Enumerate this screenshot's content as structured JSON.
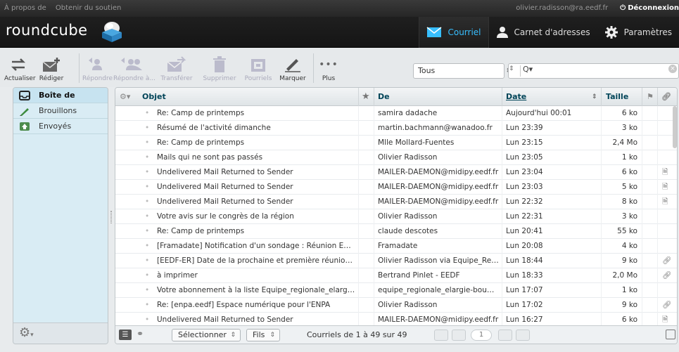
{
  "topline": {
    "about": "À propos de",
    "support": "Obtenir du soutien",
    "user": "olivier.radisson@ra.eedf.fr",
    "logout": "Déconnexion"
  },
  "header": {
    "logo": "roundcube",
    "tasks": [
      {
        "label": "Courriel",
        "icon": "mail-icon",
        "active": true
      },
      {
        "label": "Carnet d'adresses",
        "icon": "contacts-icon",
        "active": false
      },
      {
        "label": "Paramètres",
        "icon": "gear-icon",
        "active": false
      }
    ]
  },
  "toolbar": {
    "refresh": "Actualiser",
    "compose": "Rédiger",
    "reply": "Répondre",
    "reply_all": "Répondre à...",
    "forward": "Transférer",
    "delete": "Supprimer",
    "junk": "Pourriels",
    "mark": "Marquer",
    "more": "Plus",
    "filter_value": "Tous",
    "search_value": ""
  },
  "folders": [
    {
      "label": "Boîte de récep...",
      "icon": "inbox-icon",
      "selected": true
    },
    {
      "label": "Brouillons",
      "icon": "pencil-icon",
      "selected": false
    },
    {
      "label": "Envoyés",
      "icon": "sent-icon",
      "selected": false
    }
  ],
  "list": {
    "headers": {
      "subject": "Objet",
      "from": "De",
      "date": "Date",
      "size": "Taille"
    },
    "rows": [
      {
        "subject": "Re: Camp de printemps",
        "from": "samira dadache",
        "date": "Aujourd'hui 00:01",
        "size": "6 ko",
        "attach": ""
      },
      {
        "subject": "Résumé de l'activité dimanche",
        "from": "martin.bachmann@wanadoo.fr",
        "date": "Lun 23:39",
        "size": "3 ko",
        "attach": ""
      },
      {
        "subject": "Re: Camp de printemps",
        "from": "Mlle Mollard-Fuentes",
        "date": "Lun 23:15",
        "size": "2,4 Mo",
        "attach": ""
      },
      {
        "subject": "Mails qui ne sont pas passés",
        "from": "Olivier Radisson",
        "date": "Lun 23:05",
        "size": "1 ko",
        "attach": ""
      },
      {
        "subject": "Undelivered Mail Returned to Sender",
        "from": "MAILER-DAEMON@midipy.eedf.fr",
        "date": "Lun 23:04",
        "size": "6 ko",
        "attach": "doc"
      },
      {
        "subject": "Undelivered Mail Returned to Sender",
        "from": "MAILER-DAEMON@midipy.eedf.fr",
        "date": "Lun 23:03",
        "size": "5 ko",
        "attach": "doc"
      },
      {
        "subject": "Undelivered Mail Returned to Sender",
        "from": "MAILER-DAEMON@midipy.eedf.fr",
        "date": "Lun 22:32",
        "size": "8 ko",
        "attach": "doc"
      },
      {
        "subject": "Votre avis sur le congrès de la région",
        "from": "Olivier Radisson",
        "date": "Lun 22:31",
        "size": "3 ko",
        "attach": ""
      },
      {
        "subject": "Re: Camp de printemps",
        "from": "claude descotes",
        "date": "Lun 20:41",
        "size": "55 ko",
        "attach": ""
      },
      {
        "subject": "[Framadate] Notification d'un sondage : Réunion ENP...",
        "from": "Framadate",
        "date": "Lun 20:08",
        "size": "4 ko",
        "attach": ""
      },
      {
        "subject": "[EEDF-ER] Date de la prochaine et première réunion ...",
        "from": "Olivier Radisson via Equipe_Regi...",
        "date": "Lun 18:44",
        "size": "9 ko",
        "attach": "clip"
      },
      {
        "subject": "à imprimer",
        "from": "Bertrand Pinlet - EEDF",
        "date": "Lun 18:33",
        "size": "2,0 Mo",
        "attach": "clip"
      },
      {
        "subject": "Votre abonnement à la liste Equipe_regionale_elargie...",
        "from": "equipe_regionale_elargie-bounc...",
        "date": "Lun 17:07",
        "size": "1 ko",
        "attach": ""
      },
      {
        "subject": "Re: [enpa.eedf] Espace numérique pour l'ENPA",
        "from": "Olivier Radisson",
        "date": "Lun 17:02",
        "size": "9 ko",
        "attach": "clip"
      },
      {
        "subject": "Undelivered Mail Returned to Sender",
        "from": "MAILER-DAEMON@midipy.eedf.fr",
        "date": "Lun 16:27",
        "size": "6 ko",
        "attach": "doc"
      }
    ]
  },
  "footer": {
    "select": "Sélectionner",
    "threads": "Fils",
    "count": "Courriels de 1 à 49 sur 49",
    "page": "1"
  },
  "colors": {
    "accent": "#37beff",
    "selected_folder": "#c7e3f0"
  }
}
